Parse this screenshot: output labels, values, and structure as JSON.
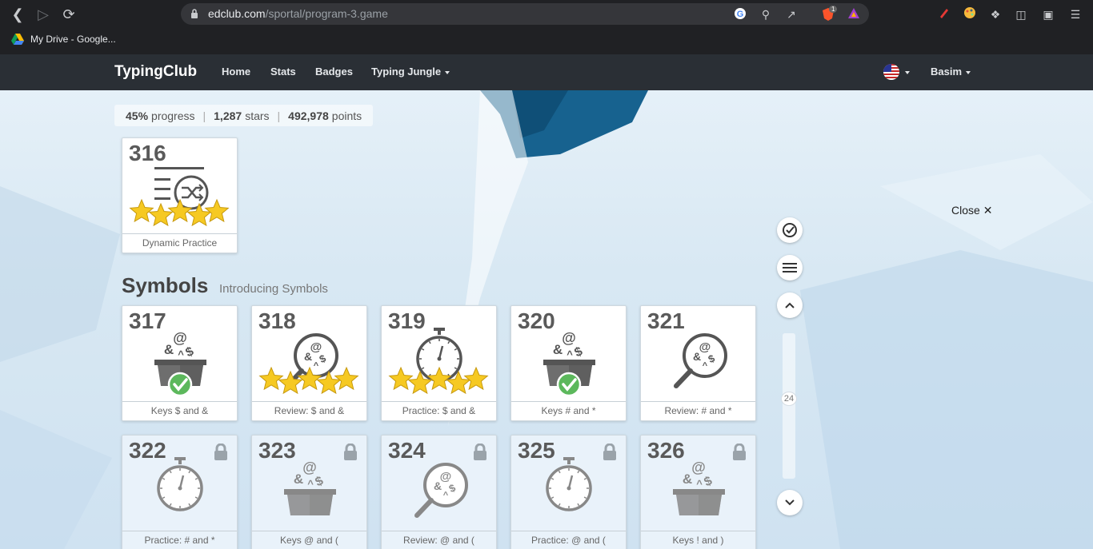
{
  "browser": {
    "url_domain": "edclub.com",
    "url_path": "/sportal/program-3.game",
    "bookmark_label": "My Drive - Google...",
    "brave_badge": "1"
  },
  "site": {
    "logo": "TypingClub",
    "nav": [
      "Home",
      "Stats",
      "Badges",
      "Typing Jungle"
    ],
    "user": "Basim"
  },
  "stats": {
    "progress_value": "45%",
    "progress_label": "progress",
    "stars_value": "1,287",
    "stars_label": "stars",
    "points_value": "492,978",
    "points_label": "points"
  },
  "close_label": "Close",
  "section": {
    "title": "Symbols",
    "subtitle": "Introducing Symbols"
  },
  "scroll_value": "24",
  "lessons": [
    {
      "num": "316",
      "label": "Dynamic Practice",
      "icon": "dynamic-practice-icon",
      "stars": 5
    },
    {
      "num": "317",
      "label": "Keys $ and &",
      "icon": "symbols-box-icon",
      "stars": 0,
      "completed": true
    },
    {
      "num": "318",
      "label": "Review: $ and &",
      "icon": "magnifier-symbols-icon",
      "stars": 5
    },
    {
      "num": "319",
      "label": "Practice: $ and &",
      "icon": "stopwatch-icon",
      "stars": 5
    },
    {
      "num": "320",
      "label": "Keys # and *",
      "icon": "symbols-box-icon",
      "stars": 0,
      "completed": true
    },
    {
      "num": "321",
      "label": "Review: # and *",
      "icon": "magnifier-symbols-icon",
      "stars": 0
    },
    {
      "num": "322",
      "label": "Practice: # and *",
      "icon": "stopwatch-icon",
      "locked": true
    },
    {
      "num": "323",
      "label": "Keys @ and (",
      "icon": "symbols-box-icon",
      "locked": true
    },
    {
      "num": "324",
      "label": "Review: @ and (",
      "icon": "magnifier-symbols-icon",
      "locked": true
    },
    {
      "num": "325",
      "label": "Practice: @ and (",
      "icon": "stopwatch-icon",
      "locked": true
    },
    {
      "num": "326",
      "label": "Keys ! and )",
      "icon": "symbols-box-icon",
      "locked": true
    }
  ]
}
